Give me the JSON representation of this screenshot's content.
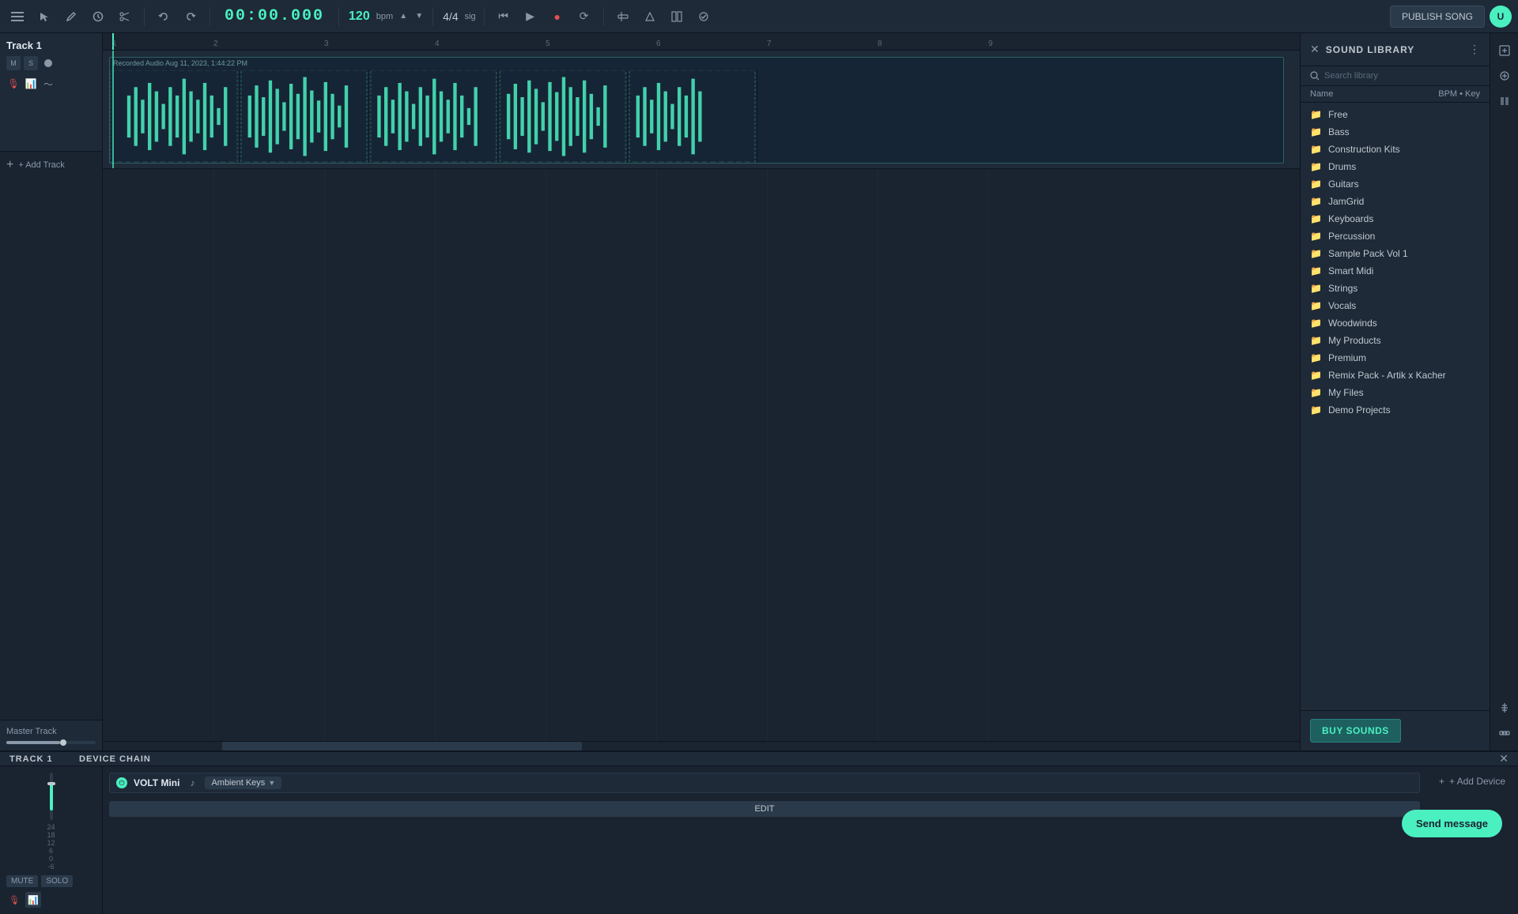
{
  "toolbar": {
    "time": "00:00.000",
    "bpm": "120",
    "bpm_label": "bpm",
    "sig": "4/4",
    "sig_label": "sig",
    "publish_label": "PUBLISH SONG"
  },
  "track1": {
    "name": "Track 1",
    "clip_label": "Recorded Audio Aug 11, 2023, 1:44:22 PM",
    "mute_label": "M",
    "solo_label": "S"
  },
  "add_track_label": "+ Add Track",
  "master_track_label": "Master Track",
  "device_chain": {
    "title": "DEVICE CHAIN",
    "track_label": "TRACK 1",
    "plugin_name": "VOLT Mini",
    "plugin_preset": "Ambient Keys",
    "edit_label": "EDIT",
    "add_device_label": "+ Add Device"
  },
  "sound_library": {
    "title": "SOUND LIBRARY",
    "search_placeholder": "Search library",
    "col_name": "Name",
    "col_bpm_key": "BPM • Key",
    "items": [
      {
        "name": "Free",
        "type": "folder"
      },
      {
        "name": "Bass",
        "type": "folder"
      },
      {
        "name": "Construction Kits",
        "type": "folder"
      },
      {
        "name": "Drums",
        "type": "folder"
      },
      {
        "name": "Guitars",
        "type": "folder"
      },
      {
        "name": "JamGrid",
        "type": "folder"
      },
      {
        "name": "Keyboards",
        "type": "folder"
      },
      {
        "name": "Percussion",
        "type": "folder"
      },
      {
        "name": "Sample Pack Vol 1",
        "type": "folder"
      },
      {
        "name": "Smart Midi",
        "type": "folder"
      },
      {
        "name": "Strings",
        "type": "folder"
      },
      {
        "name": "Vocals",
        "type": "folder"
      },
      {
        "name": "Woodwinds",
        "type": "folder"
      },
      {
        "name": "My Products",
        "type": "folder"
      },
      {
        "name": "Premium",
        "type": "folder"
      },
      {
        "name": "Remix Pack - Artik x Kacher",
        "type": "folder"
      },
      {
        "name": "My Files",
        "type": "folder"
      },
      {
        "name": "Demo Projects",
        "type": "folder"
      }
    ],
    "buy_sounds_label": "BUY SOUNDS"
  },
  "send_message_label": "Send message",
  "ruler_marks": [
    "1",
    "2",
    "3",
    "4",
    "5",
    "6",
    "7",
    "8",
    "9"
  ]
}
